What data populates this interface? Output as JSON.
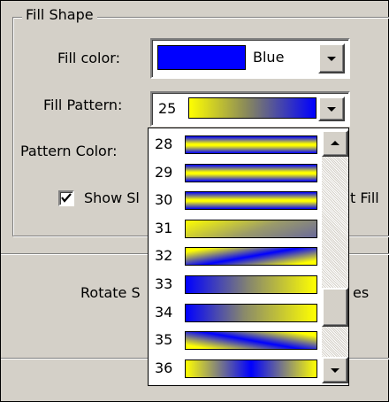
{
  "group": {
    "title": "Fill Shape"
  },
  "fill_color": {
    "label": "Fill color:",
    "value": "Blue",
    "swatch_color": "#0000ff"
  },
  "fill_pattern": {
    "label": "Fill Pattern:",
    "value": "25"
  },
  "pattern_color": {
    "label": "Pattern Color:"
  },
  "show_checkbox": {
    "label_partial": "Show Sl",
    "checked": true
  },
  "right_partial": {
    "fill_text": "t Fill",
    "es_text": "es"
  },
  "rotate": {
    "label_partial": "Rotate S"
  },
  "pattern_list": {
    "items": [
      {
        "label": "28",
        "style": "band-h"
      },
      {
        "label": "29",
        "style": "band-h"
      },
      {
        "label": "30",
        "style": "band-h"
      },
      {
        "label": "31",
        "style": "diag-down"
      },
      {
        "label": "32",
        "style": "diag-band-up"
      },
      {
        "label": "33",
        "style": "diag-up"
      },
      {
        "label": "34",
        "style": "blue-left"
      },
      {
        "label": "35",
        "style": "diag-band-down"
      },
      {
        "label": "36",
        "style": "blue-center"
      }
    ]
  },
  "colors": {
    "yellow": "#ffff00",
    "blue": "#0000ff",
    "face": "#d4d0c8"
  }
}
